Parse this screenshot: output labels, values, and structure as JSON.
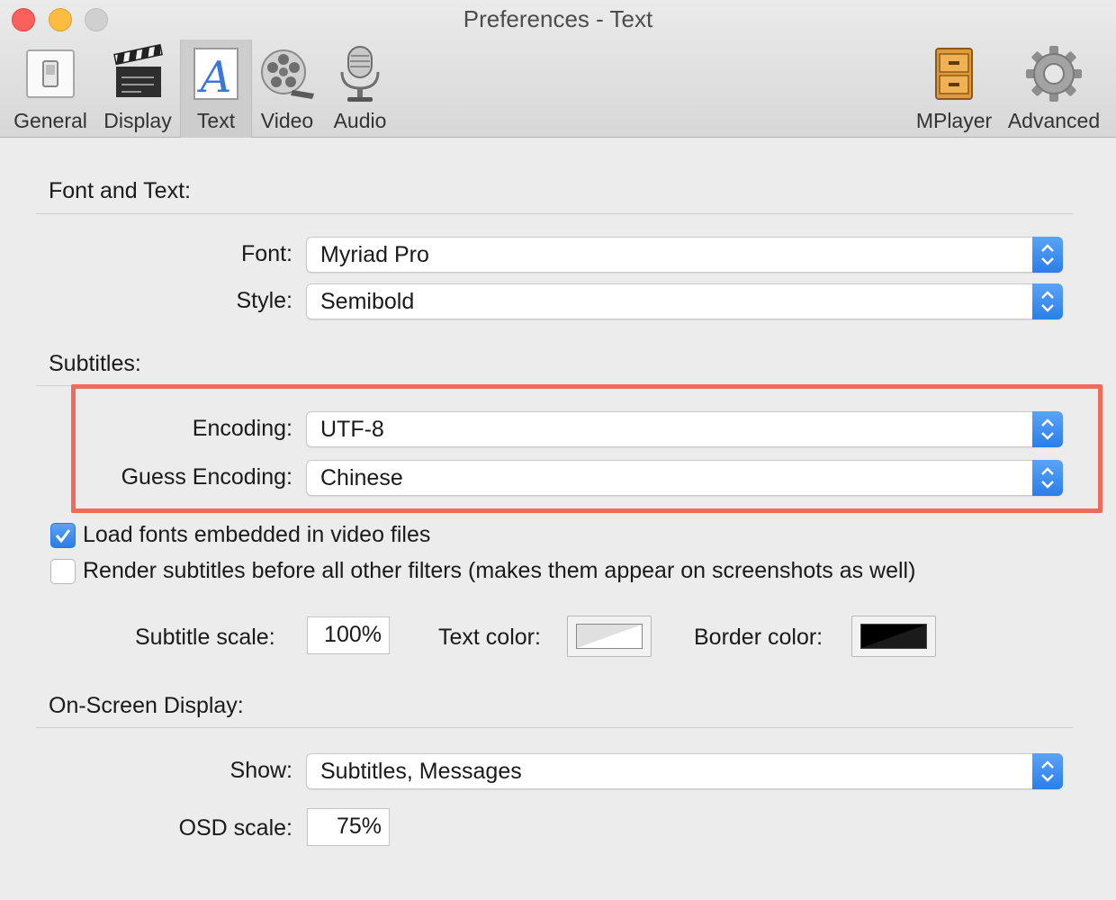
{
  "window": {
    "title": "Preferences - Text"
  },
  "toolbar": {
    "items": [
      {
        "label": "General",
        "icon": "general-switch-icon"
      },
      {
        "label": "Display",
        "icon": "clapperboard-icon"
      },
      {
        "label": "Text",
        "icon": "text-a-icon",
        "selected": true
      },
      {
        "label": "Video",
        "icon": "film-reel-icon"
      },
      {
        "label": "Audio",
        "icon": "microphone-icon"
      },
      {
        "label": "MPlayer",
        "icon": "cabinet-icon"
      },
      {
        "label": "Advanced",
        "icon": "gear-icon"
      }
    ]
  },
  "font_section": {
    "title": "Font and Text:",
    "font_label": "Font:",
    "font_value": "Myriad Pro",
    "style_label": "Style:",
    "style_value": "Semibold"
  },
  "subtitles_section": {
    "title": "Subtitles:",
    "encoding_label": "Encoding:",
    "encoding_value": "UTF-8",
    "guess_label": "Guess Encoding:",
    "guess_value": "Chinese",
    "load_fonts_label": "Load fonts embedded in video files",
    "load_fonts_checked": true,
    "render_label": "Render subtitles before all other filters (makes them appear on screenshots as well)",
    "render_checked": false,
    "scale_label": "Subtitle scale:",
    "scale_value": "100%",
    "text_color_label": "Text color:",
    "text_color": "#f2f2f2",
    "border_color_label": "Border color:",
    "border_color": "#000000"
  },
  "osd_section": {
    "title": "On-Screen Display:",
    "show_label": "Show:",
    "show_value": "Subtitles, Messages",
    "osd_scale_label": "OSD scale:",
    "osd_scale_value": "75%"
  },
  "colors": {
    "accent": "#2b7ee9",
    "highlight": "#ef6a5a"
  }
}
